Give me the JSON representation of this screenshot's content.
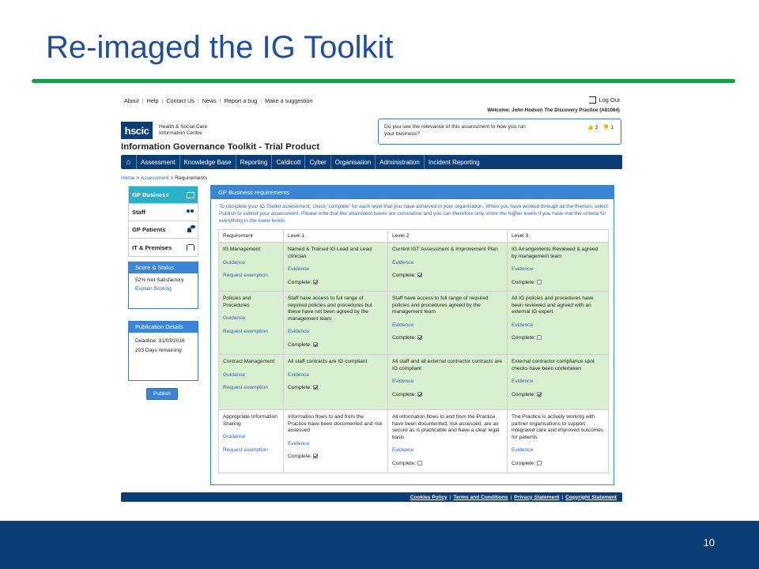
{
  "slide": {
    "title": "Re-imaged the IG Toolkit",
    "number": "10",
    "accent_color": "#1a9a4a",
    "footer_color": "#0b3d77"
  },
  "topbar": {
    "links": [
      "About",
      "Help",
      "Contact Us",
      "News",
      "Report a bug",
      "Make a suggestion"
    ],
    "logout": "Log Out",
    "welcome": "Welcome:  John Hodson  The Discovery Practice (A81064)"
  },
  "header": {
    "logo": "hscic",
    "org_line1": "Health & Social Care",
    "org_line2": "Information Centre",
    "product_title": "Information Governance Toolkit - Trial Product"
  },
  "survey": {
    "question": "Do you see the relevance of this assessment to how you run your business?",
    "up_count": "3",
    "down_count": "1"
  },
  "nav": {
    "items": [
      "Assessment",
      "Knowledge Base",
      "Reporting",
      "Caldicott",
      "Cyber",
      "Organisation",
      "Administration",
      "Incident Reporting"
    ]
  },
  "breadcrumb": {
    "home": "Home",
    "assessment": "Assessment",
    "current": "Requirements"
  },
  "sidebar": {
    "items": [
      {
        "label": "GP Business",
        "icon": "monitor-icon"
      },
      {
        "label": "Staff",
        "icon": "people-icon"
      },
      {
        "label": "GP Patients",
        "icon": "patient-icon"
      },
      {
        "label": "IT & Premises",
        "icon": "building-icon"
      }
    ],
    "score": {
      "title": "Score & Status",
      "status": "52% Not Satisfactory",
      "link": "Explain Scoring"
    },
    "publication": {
      "title": "Publication Details",
      "deadline": "Deadline: 31/03/2016",
      "remaining": "203 Days remaining"
    },
    "publish_button": "Publish"
  },
  "main": {
    "title": "GP Business requirements",
    "intro": "To complete your IG Toolkit assessment, check 'complete' for each level that you have achieved in your organisation. When you have worked through all the themes, select Publish to submit your assessment. Please note that the attainment levels are cumulative and you can therefore only score the higher levels if you have met the criteria for everything in the lower levels",
    "columns": [
      "Requirement",
      "Level 1",
      "Level 2",
      "Level 3"
    ],
    "guidance_label": "Guidance",
    "exemption_label": "Request exemption",
    "evidence_label": "Evidence",
    "complete_label": "Complete:",
    "rows": [
      {
        "requirement": "IG Management",
        "levels": [
          {
            "text": "Named & Trained IG Lead and Lead clinician",
            "complete": true
          },
          {
            "text": "Current IGT Assessment & Improvement Plan",
            "complete": true
          },
          {
            "text": "IG Arrangements Reviewed & agreed by management team",
            "complete": false
          }
        ]
      },
      {
        "requirement": "Policies and Procedures",
        "levels": [
          {
            "text": "Staff have access to full range of required policies and procedures but these have not been agreed by the management team",
            "complete": true
          },
          {
            "text": "Staff have access to full range of required policies and procedures agreed by the management team",
            "complete": true
          },
          {
            "text": "All IG policies and procedures have been reviewed and agreed with an external IG expert",
            "complete": false
          }
        ]
      },
      {
        "requirement": "Contract Management",
        "levels": [
          {
            "text": "All staff contracts are IG compliant",
            "complete": true
          },
          {
            "text": "All staff and all external contractor contracts are IG compliant",
            "complete": true
          },
          {
            "text": "External contractor compliance spot checks have been undertaken",
            "complete": true
          }
        ]
      },
      {
        "requirement": "Appropriate Information Sharing",
        "levels": [
          {
            "text": "Information flows to and from the Practice have been documented and risk assessed",
            "complete": true
          },
          {
            "text": "All information flows to and from the Practice have been documented, risk assessed, are as secure as is practicable and have a clear legal basis",
            "complete": false
          },
          {
            "text": "The Practice is actively working with partner organisations to support integrated care and improved outcomes for patients",
            "complete": false
          }
        ]
      }
    ]
  },
  "footer": {
    "links": [
      "Cookies Policy",
      "Terms and Conditions",
      "Privacy Statement",
      "Copyright Statement"
    ]
  }
}
